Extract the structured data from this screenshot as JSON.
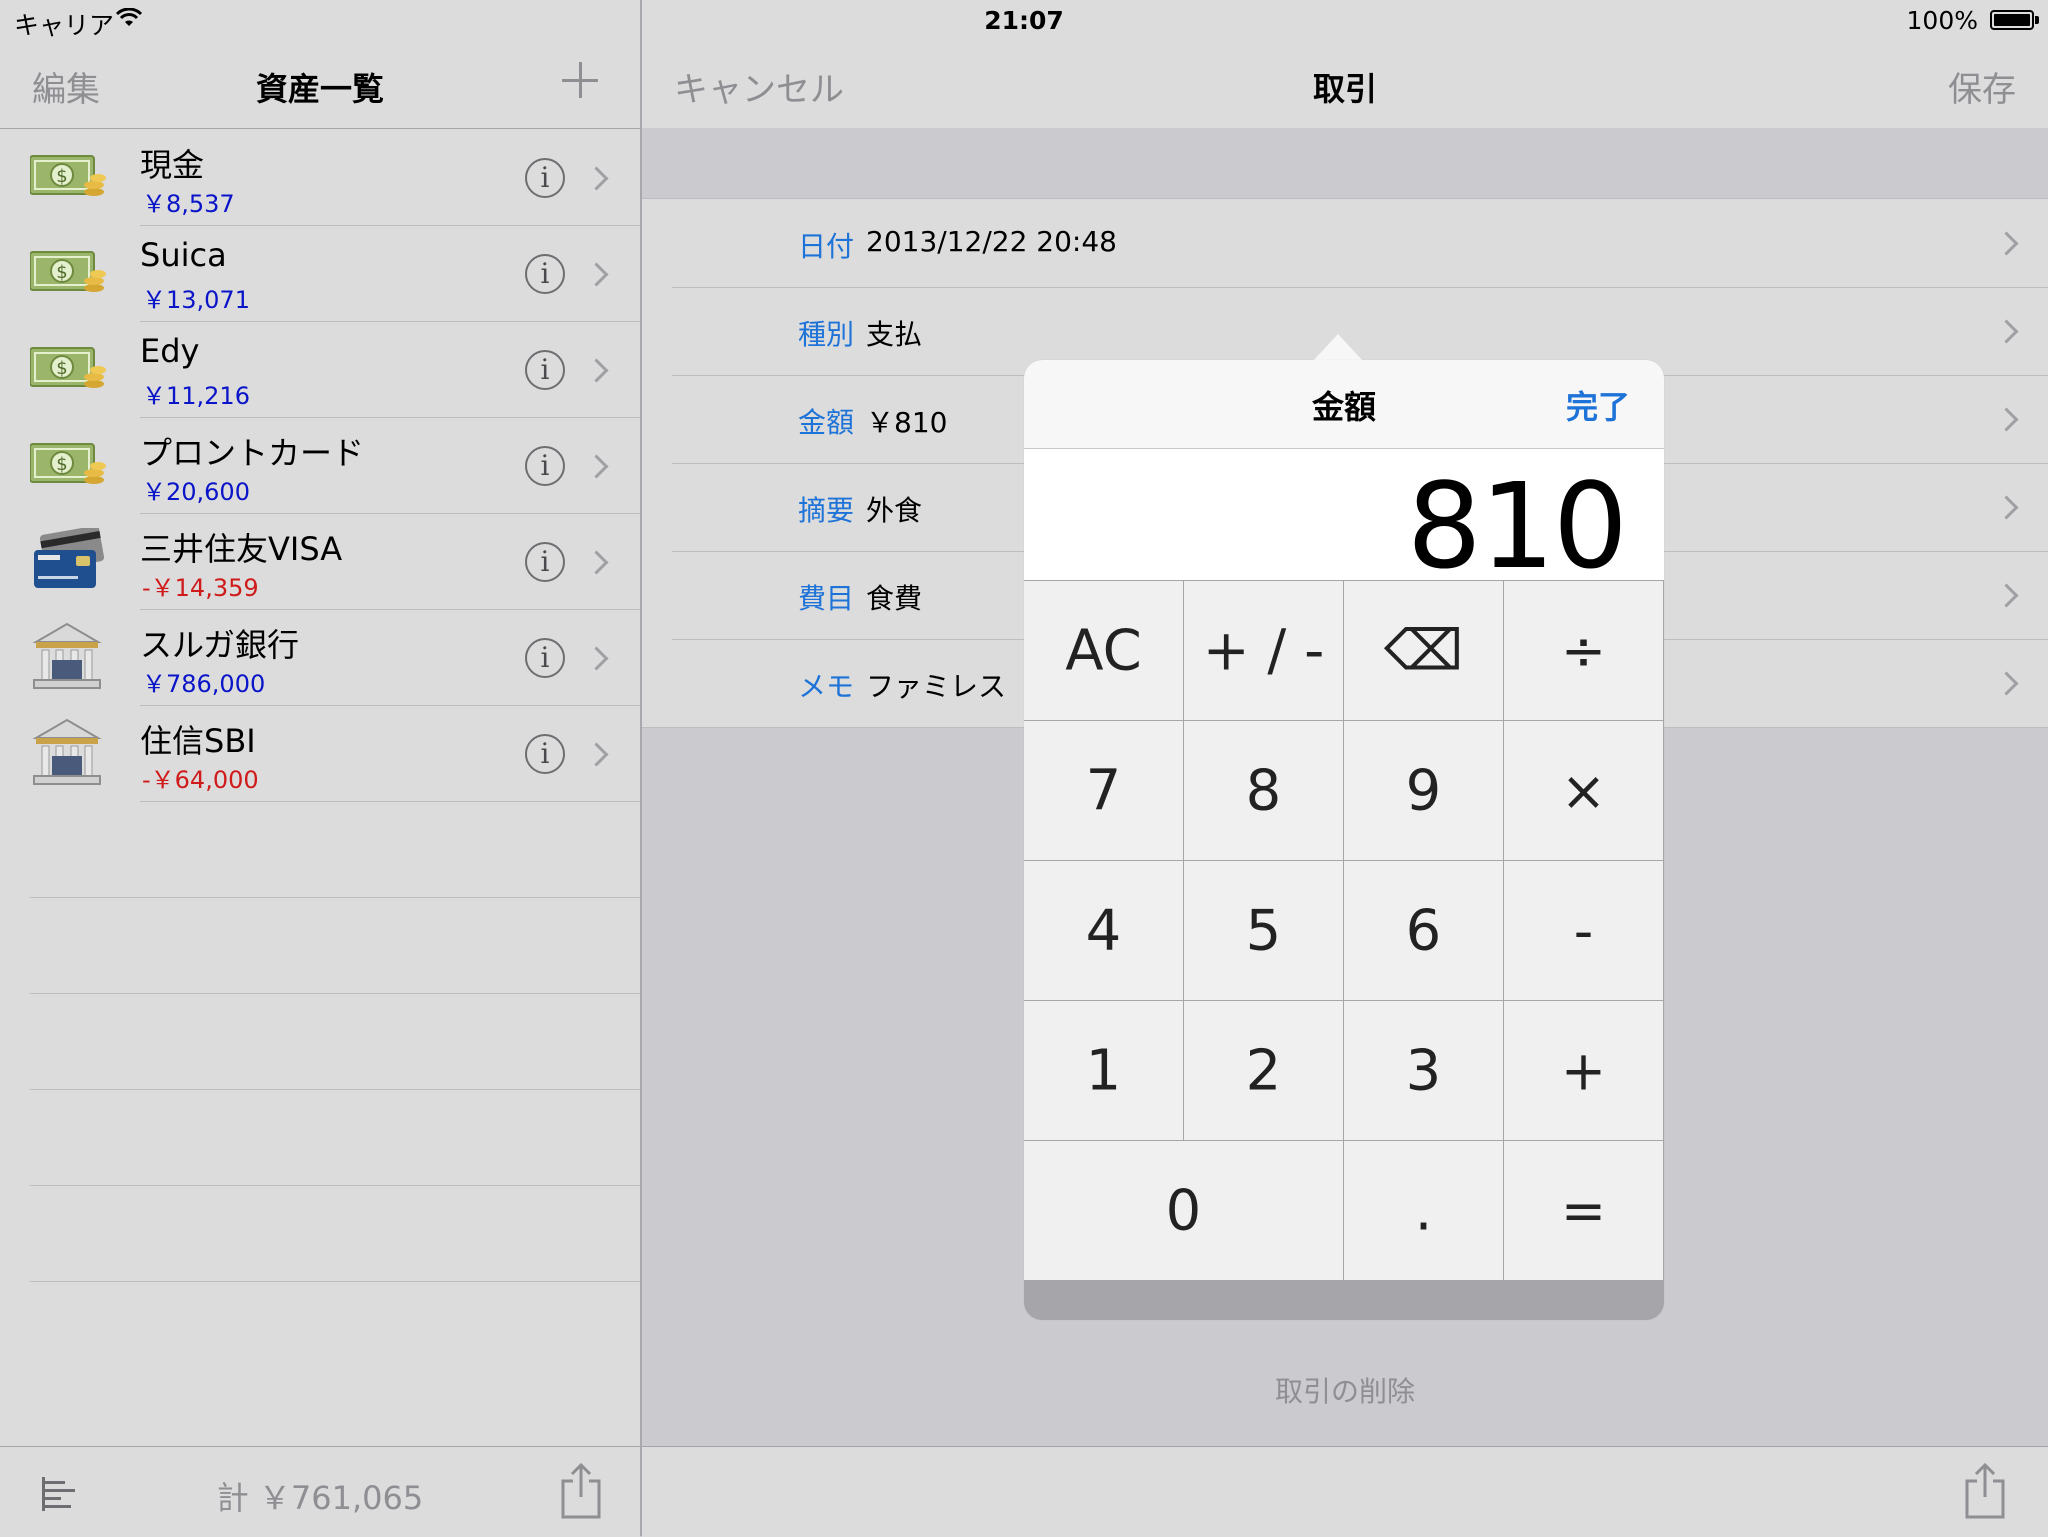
{
  "status_bar": {
    "carrier": "キャリア",
    "time": "21:07",
    "battery": "100%"
  },
  "left": {
    "nav": {
      "edit": "編集",
      "title": "資産一覧"
    },
    "assets": [
      {
        "name": "現金",
        "amount": "￥8,537",
        "icon": "cash-icon",
        "negative": false
      },
      {
        "name": "Suica",
        "amount": "￥13,071",
        "icon": "cash-icon",
        "negative": false
      },
      {
        "name": "Edy",
        "amount": "￥11,216",
        "icon": "cash-icon",
        "negative": false
      },
      {
        "name": "プロントカード",
        "amount": "￥20,600",
        "icon": "cash-icon",
        "negative": false
      },
      {
        "name": "三井住友VISA",
        "amount": "-￥14,359",
        "icon": "credit-card-icon",
        "negative": true
      },
      {
        "name": "スルガ銀行",
        "amount": "￥786,000",
        "icon": "bank-icon",
        "negative": false
      },
      {
        "name": "住信SBI",
        "amount": "-￥64,000",
        "icon": "bank-icon",
        "negative": true
      }
    ],
    "info_glyph": "i",
    "total": "計 ￥761,065"
  },
  "right": {
    "nav": {
      "cancel": "キャンセル",
      "title": "取引",
      "save": "保存"
    },
    "fields": [
      {
        "label": "日付",
        "value": "2013/12/22 20:48"
      },
      {
        "label": "種別",
        "value": "支払"
      },
      {
        "label": "金額",
        "value": "￥810"
      },
      {
        "label": "摘要",
        "value": "外食"
      },
      {
        "label": "費目",
        "value": "食費"
      },
      {
        "label": "メモ",
        "value": "ファミレス"
      }
    ],
    "delete": "取引の削除"
  },
  "popover": {
    "title": "金額",
    "done": "完了",
    "display": "810",
    "keys": [
      [
        "AC",
        "+ / -",
        "⌫",
        "÷"
      ],
      [
        "7",
        "8",
        "9",
        "×"
      ],
      [
        "4",
        "5",
        "6",
        "-"
      ],
      [
        "1",
        "2",
        "3",
        "+"
      ],
      [
        "0",
        ".",
        "="
      ]
    ]
  },
  "colors": {
    "accent": "#1e73d8",
    "positive": "#0a14c8",
    "negative": "#d01b1b",
    "muted": "#8e8e93"
  }
}
